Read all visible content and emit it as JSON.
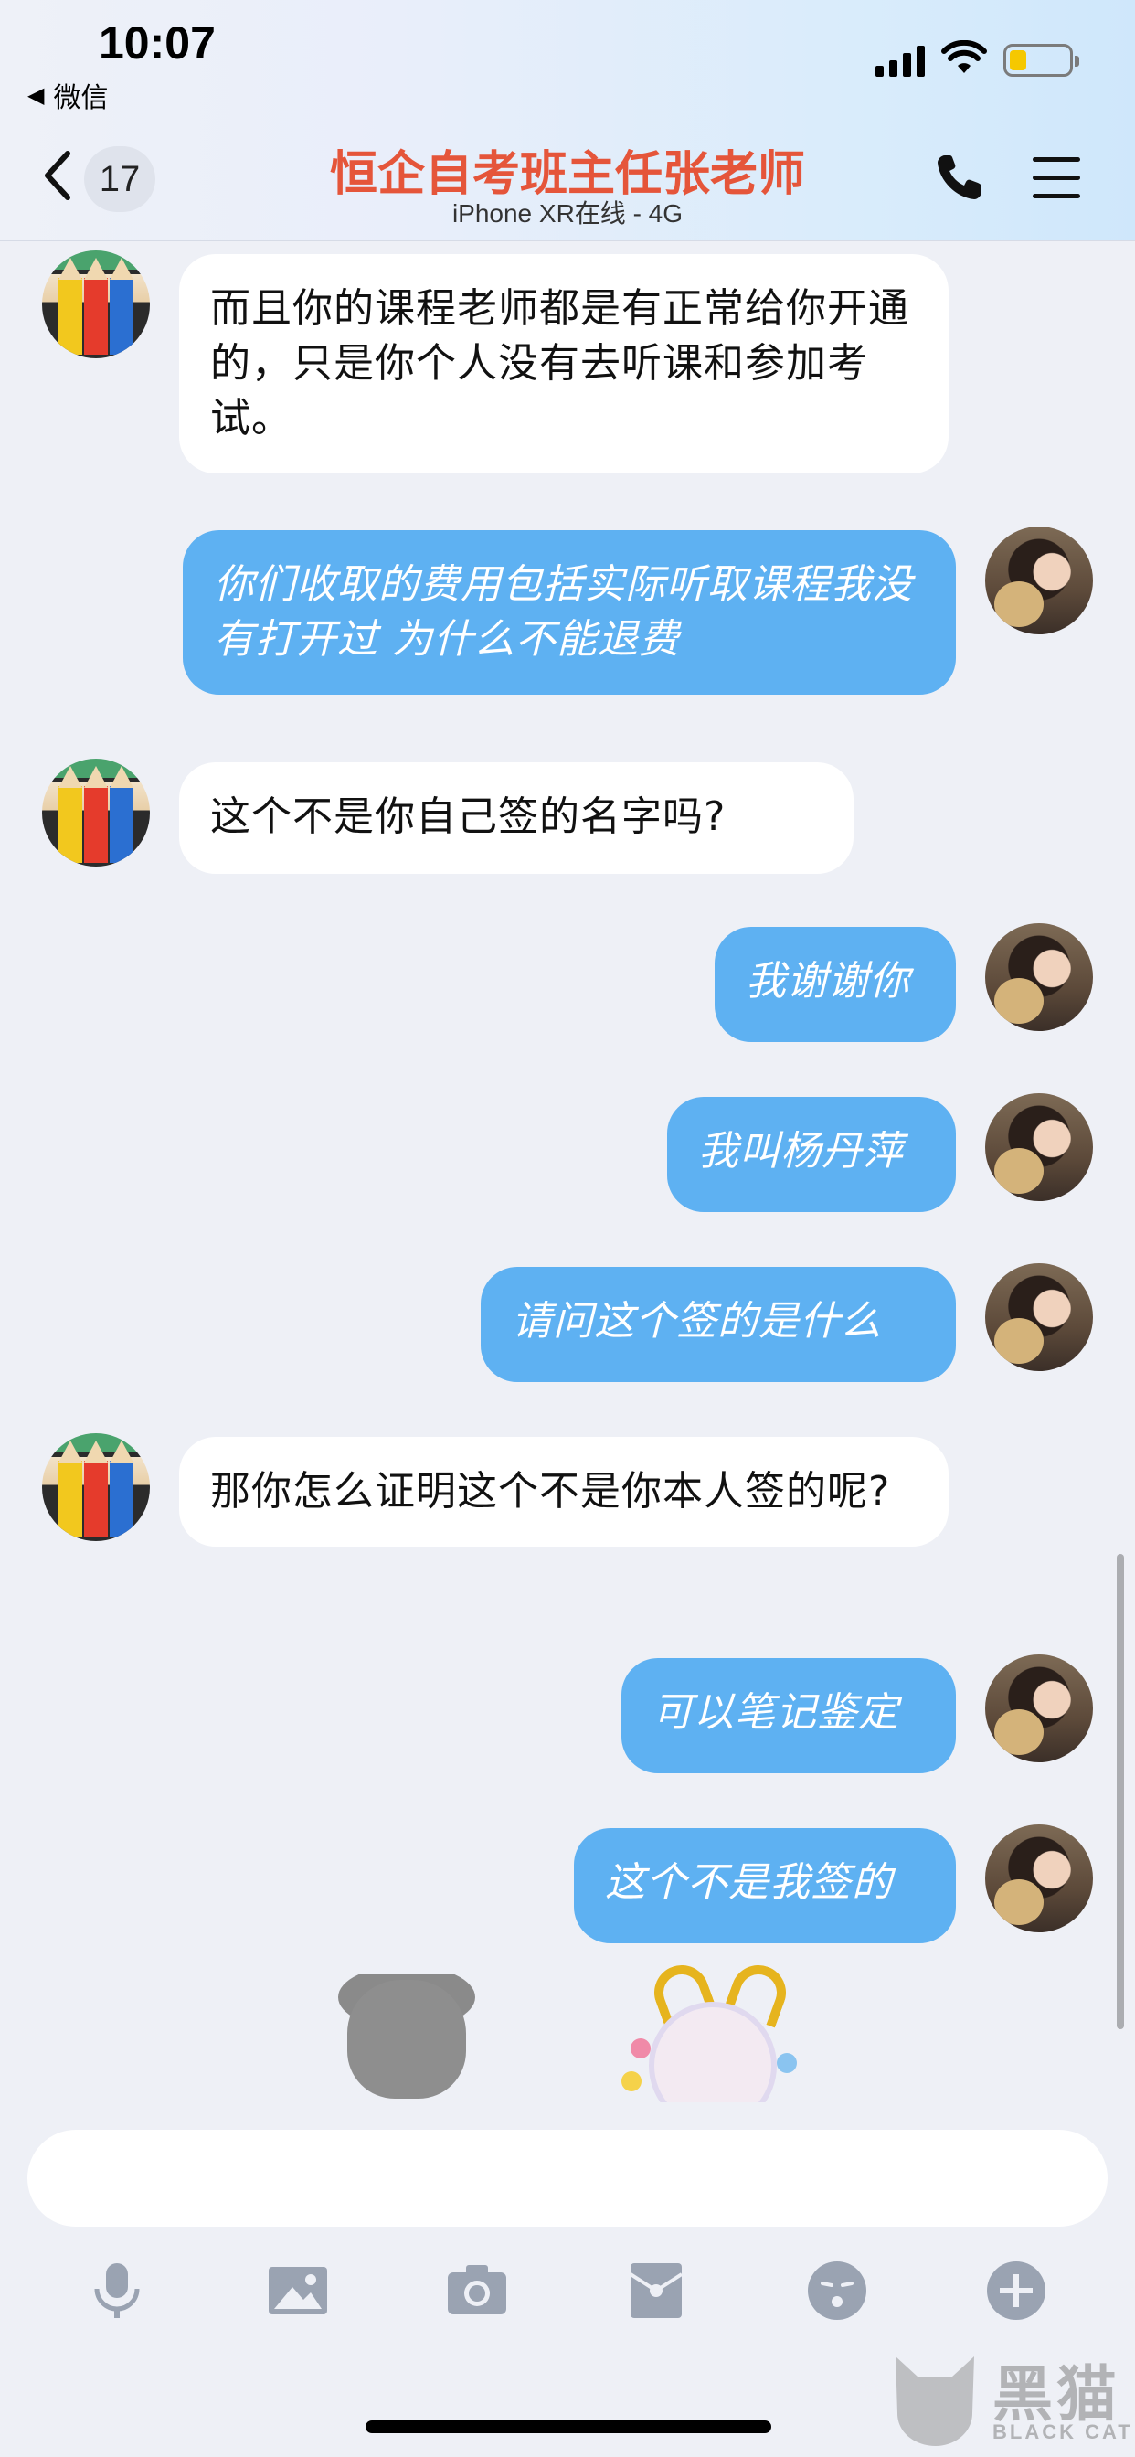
{
  "status_bar": {
    "time": "10:07",
    "back_app": "微信"
  },
  "header": {
    "unread_count": "17",
    "title": "恒企自考班主任张老师",
    "subtitle": "iPhone XR在线 - 4G"
  },
  "messages": [
    {
      "side": "left",
      "text": "而且你的课程老师都是有正常给你开通的，只是你个人没有去听课和参加考试。"
    },
    {
      "side": "right",
      "text": "你们收取的费用包括实际听取课程我没有打开过 为什么不能退费"
    },
    {
      "side": "left",
      "text": "这个不是你自己签的名字吗?"
    },
    {
      "side": "right",
      "text": "我谢谢你"
    },
    {
      "side": "right",
      "text": "我叫杨丹萍"
    },
    {
      "side": "right",
      "text": "请问这个签的是什么"
    },
    {
      "side": "left",
      "text": "那你怎么证明这个不是你本人签的呢?"
    },
    {
      "side": "right",
      "text": "可以笔记鉴定"
    },
    {
      "side": "right",
      "text": "这个不是我签的"
    }
  ],
  "input": {
    "value": "",
    "placeholder": ""
  },
  "toolbar": {
    "icons": [
      "microphone-icon",
      "image-icon",
      "camera-icon",
      "red-packet-icon",
      "emoji-icon",
      "plus-icon"
    ]
  },
  "watermark": {
    "text": "黑猫",
    "sub": "BLACK CAT"
  },
  "colors": {
    "title": "#e5553a",
    "bubble_right": "#5eb1f2",
    "bubble_left": "#ffffff",
    "background": "#eef0f6",
    "battery": "#f5c800"
  }
}
